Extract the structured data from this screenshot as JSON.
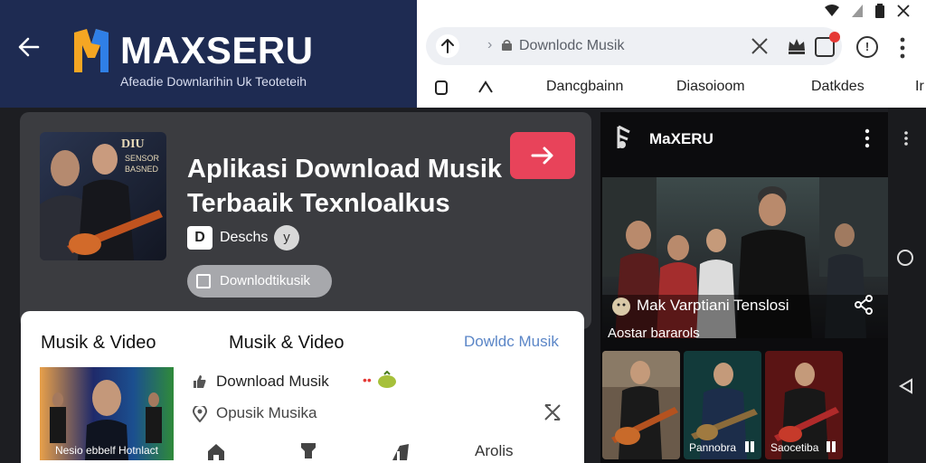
{
  "header": {
    "logo_text": "MAXSERU",
    "tagline": "Afeadie Downlarihin Uk Teoteteih"
  },
  "browser": {
    "url": "Downlodc Musik",
    "nav_items": [
      "Dancgbainn",
      "Diasoioom",
      "Datkdes",
      "Ir"
    ]
  },
  "card": {
    "album_text": [
      "DIU",
      "SENSOR",
      "BASNED"
    ],
    "title": "Aplikasi Download Musik Terbaaik Texnloalkus",
    "d_badge": "D",
    "d_label": "Deschs",
    "d_circle": "y",
    "download_pill": "Downlodtikusik"
  },
  "panel": {
    "heading_1": "Musik & Video",
    "heading_2": "Musik & Video",
    "heading_link": "Dowldc Musik",
    "thumb_caption": "Nesio ebbelf Hotnlact",
    "row_1": "Download Musik",
    "row_2": "Opusik Musika",
    "bottom_label": "Arolis"
  },
  "phone": {
    "app_title": "MaXERU",
    "hero_caption": "Mak Varptiani Tenslosi",
    "section_label": "Aostar bararols",
    "thumbs": [
      {
        "caption": ""
      },
      {
        "caption": "Pannobra"
      },
      {
        "caption": "Saocetiba"
      }
    ]
  },
  "colors": {
    "header_bg": "#1e2b52",
    "card_bg": "#3b3c40",
    "accent_red": "#e8435a",
    "link_blue": "#5b86c7",
    "logo_orange": "#f5a623",
    "logo_blue": "#2f7fe6"
  }
}
